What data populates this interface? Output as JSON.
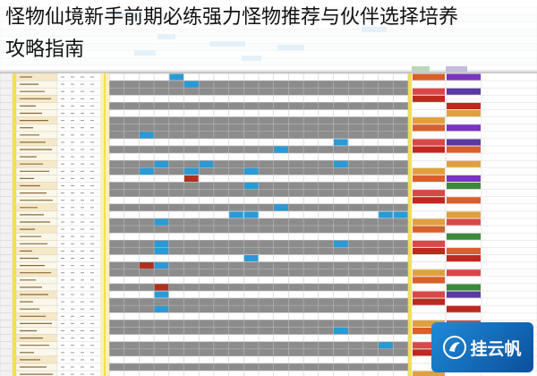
{
  "page": {
    "title_line1": "怪物仙境新手前期必练强力怪物推荐与伙伴选择培养",
    "title_line2": "攻略指南"
  },
  "watermark": {
    "text": "挂云帆",
    "logo_icon": "cloud-sail-logo"
  },
  "colors": {
    "highlight_yellow": "#f4e04a",
    "grid_gray": "#8c8c8c",
    "cell_blue": "#2a9ad6",
    "cell_red": "#b0301e",
    "tag_orange": "#d8602a",
    "tag_purple": "#7a34c0",
    "tag_red": "#c0281e",
    "tag_green": "#3a8a3a"
  }
}
